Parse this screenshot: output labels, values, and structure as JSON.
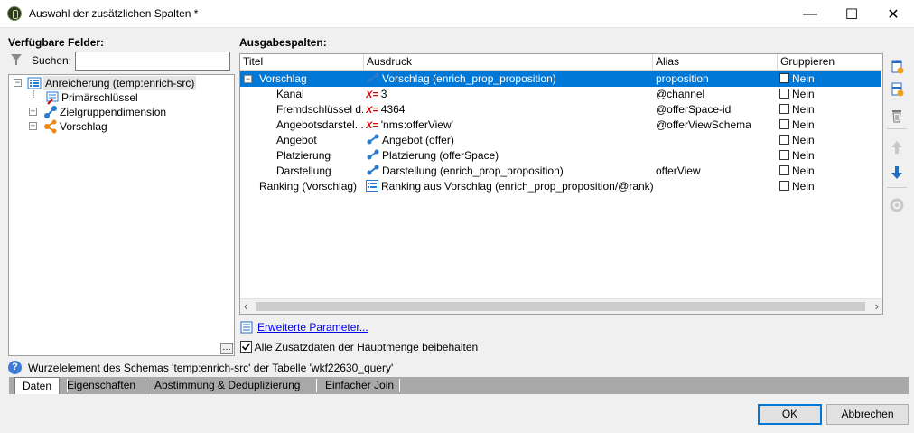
{
  "window": {
    "title": "Auswahl der zusätzlichen Spalten *",
    "minimize": "—",
    "maximize": "☐",
    "close": "✕"
  },
  "left": {
    "heading": "Verfügbare Felder:",
    "search_label": "Suchen:",
    "search_value": "",
    "tree": [
      {
        "label": "Anreicherung (temp:enrich-src)",
        "expander": "−",
        "icon": "list-icon"
      },
      {
        "label": "Primärschlüssel",
        "icon": "key-icon"
      },
      {
        "label": "Zielgruppendimension",
        "expander": "+",
        "icon": "link-icon"
      },
      {
        "label": "Vorschlag",
        "expander": "+",
        "icon": "share-icon"
      }
    ],
    "more": "…"
  },
  "right": {
    "heading": "Ausgabespalten:",
    "columns": [
      "Titel",
      "Ausdruck",
      "Alias",
      "Gruppieren"
    ],
    "rows": [
      {
        "title": "Vorschlag",
        "expander": "−",
        "expr_icon": "link-icon",
        "expr": "Vorschlag (enrich_prop_proposition)",
        "alias": "proposition",
        "group": "Nein"
      },
      {
        "title": "Kanal",
        "expr_icon": "formula-icon",
        "expr": "3",
        "alias": "@channel",
        "group": "Nein"
      },
      {
        "title": "Fremdschlüssel d...",
        "expr_icon": "formula-icon",
        "expr": "4364",
        "alias": "@offerSpace-id",
        "group": "Nein"
      },
      {
        "title": "Angebotsdarstel...",
        "expr_icon": "formula-icon",
        "expr": "'nms:offerView'",
        "alias": "@offerViewSchema",
        "group": "Nein"
      },
      {
        "title": "Angebot",
        "expr_icon": "link-icon",
        "expr": "Angebot (offer)",
        "alias": "",
        "group": "Nein"
      },
      {
        "title": "Platzierung",
        "expr_icon": "link-icon",
        "expr": "Platzierung (offerSpace)",
        "alias": "",
        "group": "Nein"
      },
      {
        "title": "Darstellung",
        "expr_icon": "link-icon",
        "expr": "Darstellung (enrich_prop_proposition)",
        "alias": "offerView",
        "group": "Nein"
      },
      {
        "title": "Ranking (Vorschlag)",
        "expr_icon": "list-icon",
        "expr": "Ranking aus Vorschlag (enrich_prop_proposition/@rank)",
        "alias": "",
        "group": "Nein"
      }
    ],
    "formula_glyph": "X=",
    "scroll_left": "‹",
    "scroll_right": "›",
    "advanced_link": "Erweiterte Parameter...",
    "keep_checkbox": {
      "label": "Alle Zusatzdaten der Hauptmenge beibehalten",
      "checked": true
    }
  },
  "info": "Wurzelelement des Schemas 'temp:enrich-src' der Tabelle 'wkf22630_query'",
  "info_glyph": "?",
  "tabs": [
    "Daten",
    "Eigenschaften",
    "Abstimmung & Deduplizierung",
    "Einfacher Join"
  ],
  "buttons": {
    "ok": "OK",
    "cancel": "Abbrechen"
  },
  "side_icons": [
    "add-icon",
    "add-child-icon",
    "delete-icon",
    "move-up-icon",
    "move-down-icon",
    "distribute-icon"
  ]
}
